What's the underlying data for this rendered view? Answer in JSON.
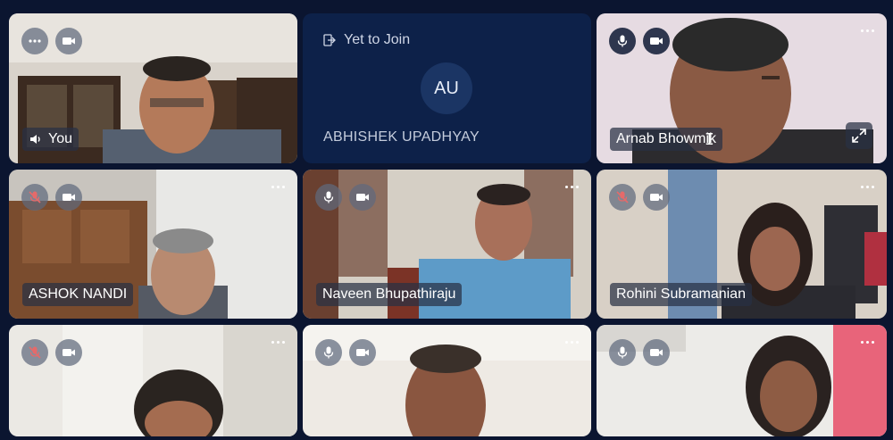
{
  "participants": [
    {
      "name": "You",
      "mic": "on-speaker",
      "camera": "on"
    },
    {
      "name": "ABHISHEK UPADHYAY",
      "status": "Yet to Join",
      "initials": "AU"
    },
    {
      "name": "Arnab Bhowmik",
      "mic": "on",
      "camera": "on"
    },
    {
      "name": "ASHOK NANDI",
      "mic": "muted",
      "camera": "on"
    },
    {
      "name": "Naveen Bhupathiraju",
      "mic": "on",
      "camera": "on"
    },
    {
      "name": "Rohini Subramanian",
      "mic": "muted",
      "camera": "on"
    },
    {
      "name": "",
      "mic": "muted",
      "camera": "on"
    },
    {
      "name": "",
      "mic": "on",
      "camera": "on"
    },
    {
      "name": "",
      "mic": "on",
      "camera": "on"
    }
  ],
  "icons": {
    "more": "more-horizontal-icon",
    "mic": "microphone-icon",
    "mic_muted": "microphone-off-icon",
    "camera": "video-camera-icon",
    "expand": "expand-icon",
    "join": "sign-in-icon",
    "speaker": "speaker-icon"
  },
  "colors": {
    "background": "#0b1530",
    "yet_tile": "#0d2149",
    "avatar": "#1b3564",
    "muted": "#e56a6a"
  }
}
